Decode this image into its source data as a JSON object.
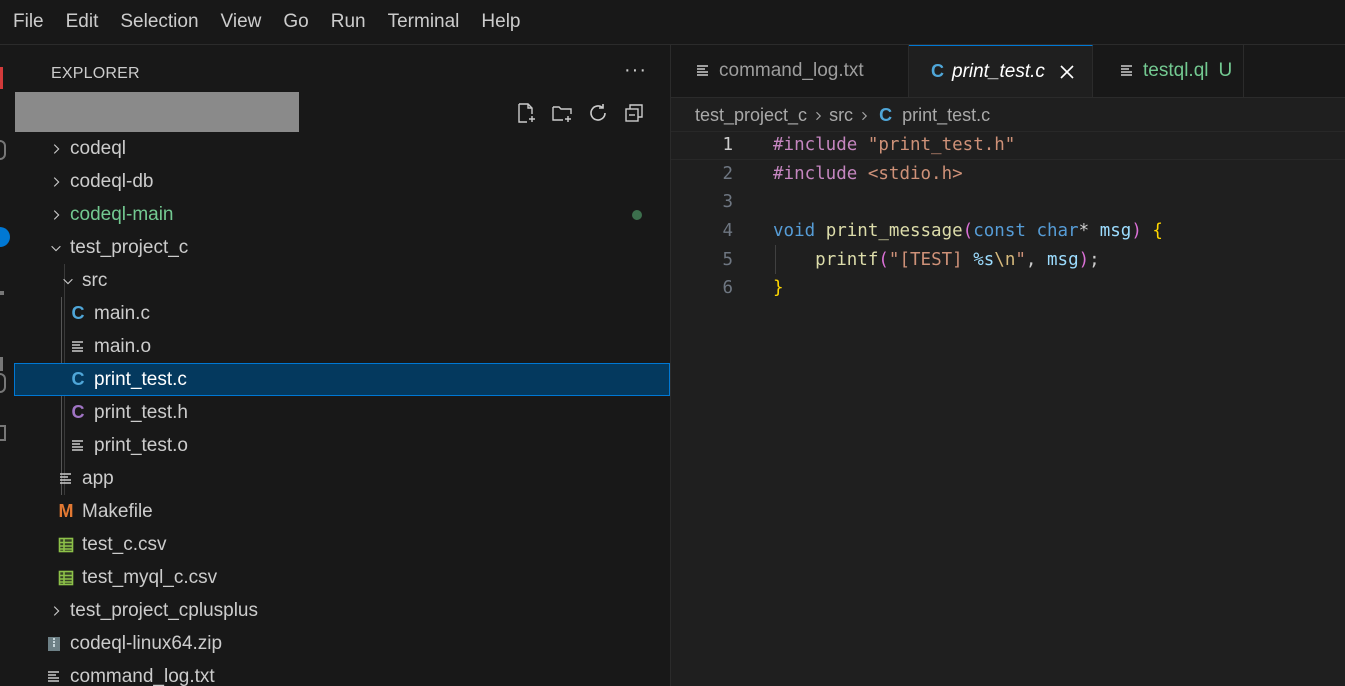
{
  "menu": [
    "File",
    "Edit",
    "Selection",
    "View",
    "Go",
    "Run",
    "Terminal",
    "Help"
  ],
  "explorer": {
    "title": "EXPLORER",
    "more": "···"
  },
  "tree": [
    {
      "label": "codeql",
      "kind": "folder",
      "expanded": false,
      "depth": 0
    },
    {
      "label": "codeql-db",
      "kind": "folder",
      "expanded": false,
      "depth": 0
    },
    {
      "label": "codeql-main",
      "kind": "folder",
      "expanded": false,
      "depth": 0,
      "modified": true
    },
    {
      "label": "test_project_c",
      "kind": "folder",
      "expanded": true,
      "depth": 0
    },
    {
      "label": "src",
      "kind": "folder",
      "expanded": true,
      "depth": 1
    },
    {
      "label": "main.c",
      "kind": "c-file",
      "depth": 2
    },
    {
      "label": "main.o",
      "kind": "text-file",
      "depth": 2
    },
    {
      "label": "print_test.c",
      "kind": "c-file",
      "depth": 2,
      "selected": true
    },
    {
      "label": "print_test.h",
      "kind": "h-file",
      "depth": 2
    },
    {
      "label": "print_test.o",
      "kind": "text-file",
      "depth": 2
    },
    {
      "label": "app",
      "kind": "text-file",
      "depth": 1
    },
    {
      "label": "Makefile",
      "kind": "makefile",
      "depth": 1
    },
    {
      "label": "test_c.csv",
      "kind": "csv-file",
      "depth": 1
    },
    {
      "label": "test_myql_c.csv",
      "kind": "csv-file",
      "depth": 1
    },
    {
      "label": "test_project_cplusplus",
      "kind": "folder",
      "expanded": false,
      "depth": 0
    },
    {
      "label": "codeql-linux64.zip",
      "kind": "zip-file",
      "depth": 0
    },
    {
      "label": "command_log.txt",
      "kind": "text-file",
      "depth": 0
    }
  ],
  "tabs": [
    {
      "label": "command_log.txt",
      "icon": "text-lines-icon",
      "active": false
    },
    {
      "label": "print_test.c",
      "icon": "c-icon",
      "active": true,
      "close": "×"
    },
    {
      "label": "testql.ql",
      "icon": "text-lines-icon",
      "active": false,
      "status": "U"
    }
  ],
  "breadcrumb": {
    "parts": [
      "test_project_c",
      "src"
    ],
    "icon": "C",
    "file": "print_test.c"
  },
  "code": {
    "current_line": 1,
    "lines": [
      {
        "n": "1"
      },
      {
        "n": "2"
      },
      {
        "n": "3"
      },
      {
        "n": "4"
      },
      {
        "n": "5"
      },
      {
        "n": "6"
      }
    ],
    "tokens": {
      "l1_kw": "#include",
      "l1_str": "\"print_test.h\"",
      "l2_kw": "#include",
      "l2_str": "<stdio.h>",
      "l4_void": "void",
      "l4_fn": "print_message",
      "l4_open": "(",
      "l4_const": "const",
      "l4_char": "char",
      "l4_star": "*",
      "l4_msg": "msg",
      "l4_close": ")",
      "l4_brace": "{",
      "l5_fn": "printf",
      "l5_open": "(",
      "l5_str1": "\"[TEST] ",
      "l5_fmt": "%s",
      "l5_esc": "\\n",
      "l5_str2": "\"",
      "l5_comma": ", ",
      "l5_msg": "msg",
      "l5_close": ")",
      "l5_semi": ";",
      "l6_brace": "}"
    }
  },
  "colors": {
    "accent": "#0078d4",
    "selection_bg": "#04395e",
    "c_icon": "#4fa6d8",
    "h_icon": "#a074c4",
    "untracked": "#73c991"
  }
}
